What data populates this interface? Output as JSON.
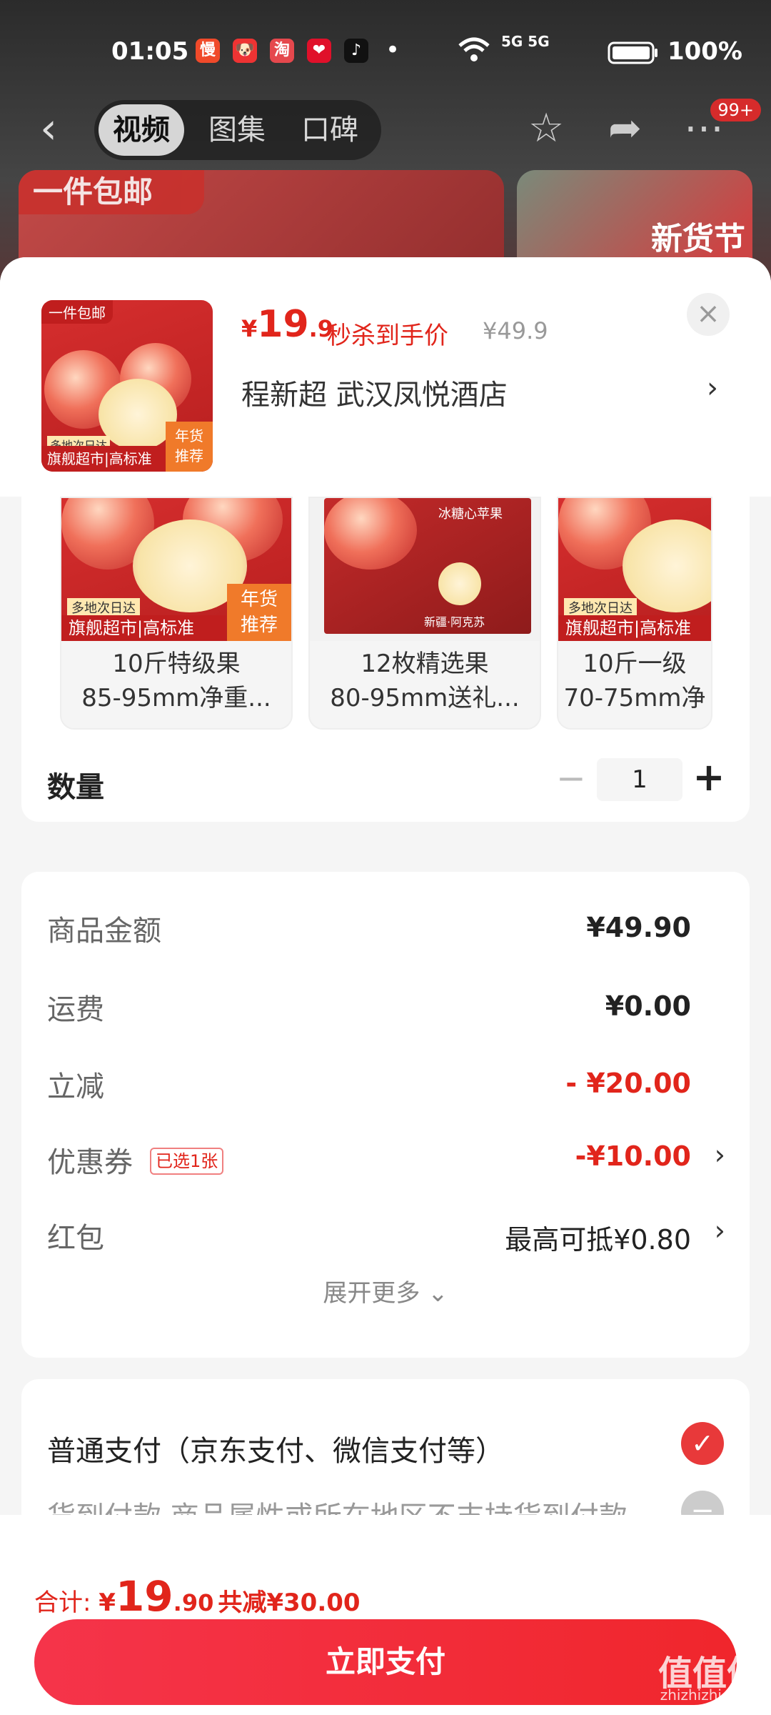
{
  "status_bar": {
    "time": "01:05",
    "apps": [
      "慢",
      "🐶",
      "淘",
      "❤",
      "♪"
    ],
    "dot": "•",
    "network": "5G 5G",
    "battery": "100%"
  },
  "nav": {
    "tabs": [
      "视频",
      "图集",
      "口碑"
    ],
    "badge": "99+"
  },
  "background": {
    "banner_text": "一件包邮",
    "right_text": "新货节"
  },
  "product": {
    "thumb_tag": "一件包邮",
    "thumb_footer": "旗舰超市|高标准",
    "thumb_corner_1": "年货",
    "thumb_corner_2": "推荐",
    "thumb_small": "多地次日达",
    "price_yen": "¥",
    "price_int": "19",
    "price_dec": ".9",
    "price_label": "秒杀到手价",
    "price_original": "¥49.9",
    "address": "程新超  武汉凤悦酒店"
  },
  "specs": [
    {
      "line1": "10斤特级果",
      "line2": "85-95mm净重...",
      "footer": "旗舰超市|高标准",
      "small": "多地次日达",
      "corner1": "年货",
      "corner2": "推荐"
    },
    {
      "line1": "12枚精选果",
      "line2": "80-95mm送礼...",
      "box_text": "冰糖心苹果",
      "box_sub": "新疆·阿克苏"
    },
    {
      "line1": "10斤一级",
      "line2": "70-75mm净",
      "footer": "旗舰超市|高标准",
      "small": "多地次日达"
    }
  ],
  "quantity": {
    "label": "数量",
    "minus": "−",
    "value": "1",
    "plus": "+"
  },
  "summary": {
    "rows": [
      {
        "label": "商品金额",
        "value": "¥49.90"
      },
      {
        "label": "运费",
        "value": "¥0.00"
      },
      {
        "label": "立减",
        "value": "- ¥20.00"
      },
      {
        "label": "优惠券",
        "value": "-¥10.00",
        "badge": "已选1张"
      },
      {
        "label": "红包",
        "value": "最高可抵¥0.80"
      }
    ],
    "expand": "展开更多 ⌄"
  },
  "payment": {
    "option1": "普通支付（京东支付、微信支付等）",
    "option2": "货到付款  商品属性或所在地区不支持货到付款"
  },
  "footer": {
    "total_label": "合计: ",
    "total_yen": "¥",
    "total_int": "19",
    "total_dec": ".90",
    "total_save": "共减¥30.00",
    "pay_button": "立即支付"
  },
  "watermark": {
    "main": "值值值",
    "sub": "zhizhizhi.com"
  },
  "colors": {
    "accent": "#e1251b",
    "button": "#f0262c"
  }
}
